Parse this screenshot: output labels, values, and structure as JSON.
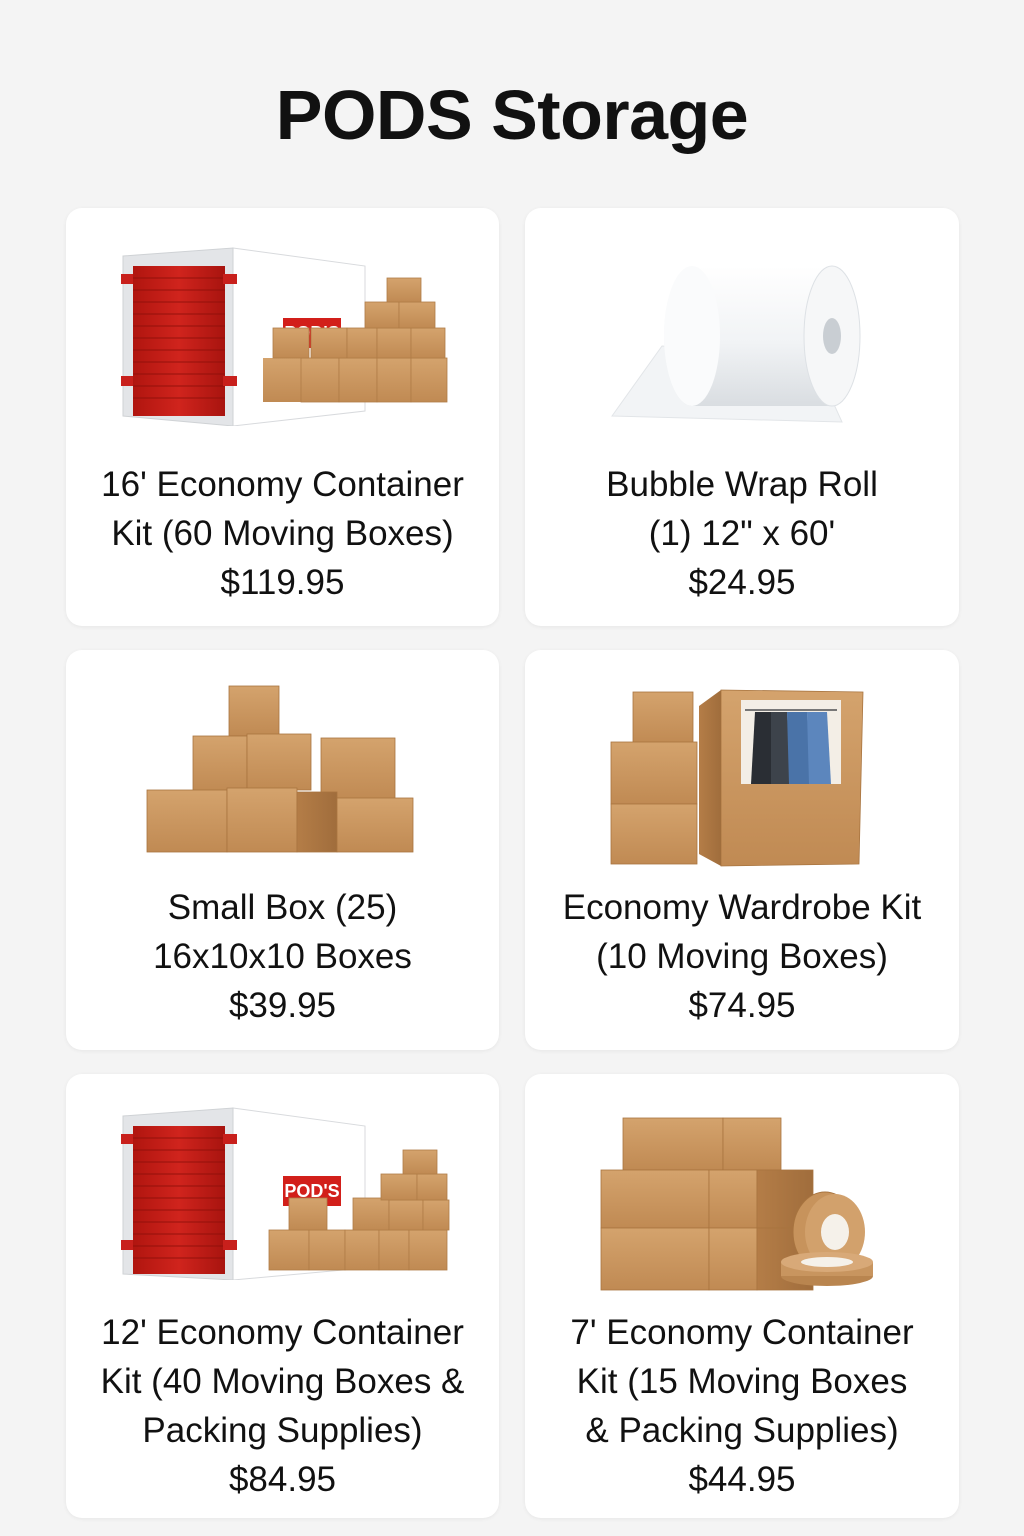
{
  "page": {
    "title": "PODS Storage"
  },
  "container_badge": "POD'S",
  "colors": {
    "background": "#f4f4f4",
    "card": "#ffffff",
    "container_door": "#c8201c",
    "cardboard": "#c9955e"
  },
  "products": [
    {
      "name_lines": [
        "16' Economy Container",
        "Kit (60 Moving Boxes)"
      ],
      "price": "$119.95",
      "image": "container-with-boxes"
    },
    {
      "name_lines": [
        "Bubble Wrap Roll",
        "(1) 12\" x 60'"
      ],
      "price": "$24.95",
      "image": "bubble-wrap-roll"
    },
    {
      "name_lines": [
        "Small Box (25)",
        "16x10x10 Boxes"
      ],
      "price": "$39.95",
      "image": "box-stack"
    },
    {
      "name_lines": [
        "Economy Wardrobe Kit",
        "(10 Moving Boxes)"
      ],
      "price": "$74.95",
      "image": "wardrobe-box"
    },
    {
      "name_lines": [
        "12' Economy Container",
        "Kit (40 Moving Boxes &",
        "Packing Supplies)"
      ],
      "price": "$84.95",
      "image": "container-with-boxes"
    },
    {
      "name_lines": [
        "7' Economy Container",
        "Kit (15 Moving Boxes",
        "& Packing Supplies)"
      ],
      "price": "$44.95",
      "image": "boxes-with-tape"
    }
  ]
}
